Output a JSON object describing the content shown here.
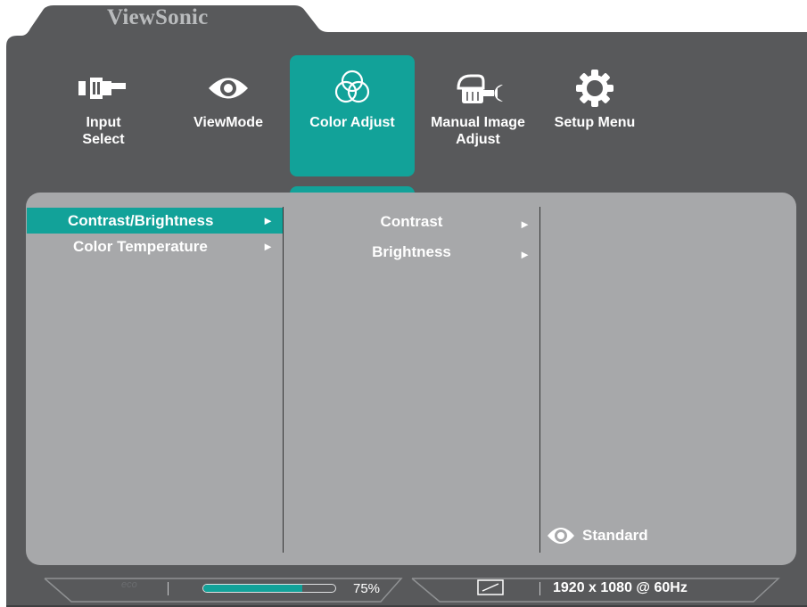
{
  "brand": "ViewSonic",
  "tabs": [
    {
      "label": "Input\nSelect",
      "icon": "input-select-icon",
      "active": false
    },
    {
      "label": "ViewMode",
      "icon": "eye-icon",
      "active": false
    },
    {
      "label": "Color Adjust",
      "icon": "color-circles-icon",
      "active": true
    },
    {
      "label": "Manual Image\nAdjust",
      "icon": "hand-wrench-icon",
      "active": false
    },
    {
      "label": "Setup Menu",
      "icon": "gear-icon",
      "active": false
    }
  ],
  "menu_level1": [
    {
      "label": "Contrast/Brightness",
      "selected": true
    },
    {
      "label": "Color Temperature",
      "selected": false
    }
  ],
  "menu_level2": [
    {
      "label": "Contrast"
    },
    {
      "label": "Brightness"
    }
  ],
  "arrow_glyph": "►",
  "view_mode": {
    "label": "Standard",
    "icon": "eye-icon"
  },
  "status_bar": {
    "eco_label": "eco",
    "progress_percent": 75,
    "progress_text": "75%",
    "aspect_icon": "aspect-ratio-icon",
    "resolution": "1920 x 1080 @ 60Hz"
  },
  "colors": {
    "accent": "#12a299",
    "frame": "#58595b",
    "panel": "#a7a8aa",
    "text": "#ffffff"
  }
}
